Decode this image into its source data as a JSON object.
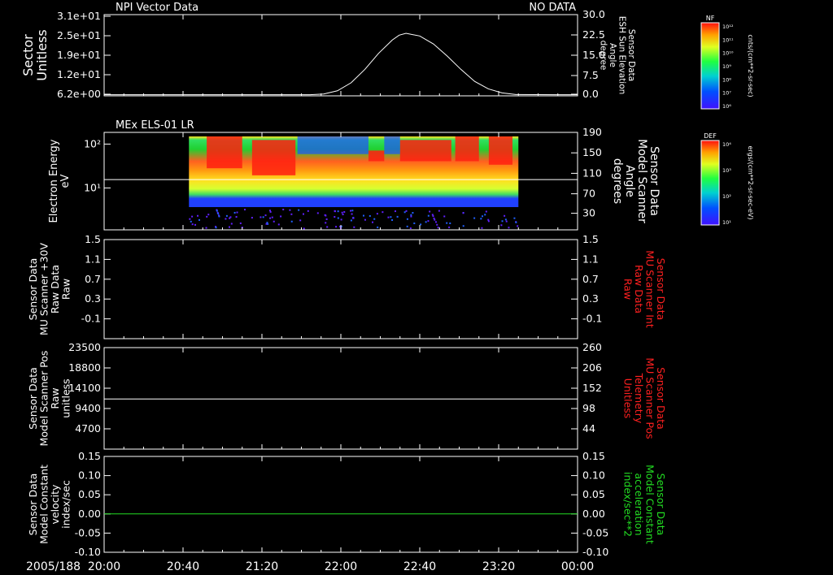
{
  "colors": {
    "background": "#000000",
    "axis": "#ffffff",
    "red_label": "#ff2020",
    "green": "#22dd22"
  },
  "chart_data": [
    {
      "type": "line",
      "title": "NPI Vector Data",
      "title_right": "NO DATA",
      "ylabel": [
        "Sector",
        "Unitless"
      ],
      "yticks": [
        "3.1e+01",
        "2.5e+01",
        "1.9e+01",
        "1.2e+01",
        "6.2e+00"
      ],
      "y2label": [
        "Sensor Data",
        "ESH Sun Elevation",
        "Angle",
        "degree"
      ],
      "y2ticks": [
        "30.0",
        "22.5",
        "15.0",
        "7.5",
        "0.0"
      ],
      "y2lim": [
        -0.4,
        30.0
      ],
      "series": [
        {
          "x": [
            0,
            150,
            160,
            170,
            180,
            190,
            200,
            210,
            215,
            220,
            230,
            240,
            250,
            260,
            270,
            280,
            290,
            300,
            330,
            345
          ],
          "y": [
            0,
            0,
            0.3,
            1.5,
            4.5,
            9.5,
            15.5,
            20.5,
            22.3,
            23.0,
            22.0,
            19.0,
            14.5,
            9.5,
            5.0,
            2.2,
            0.7,
            0.1,
            0,
            0
          ]
        }
      ],
      "color": "#ffffff",
      "colorbar": {
        "label": "NF",
        "units": "cnts/(cm**2-sr-sec)",
        "ticks": [
          "10¹²",
          "10¹¹",
          "10¹⁰",
          "10⁹",
          "10⁸",
          "10⁷",
          "10⁶"
        ]
      }
    },
    {
      "type": "heatmap",
      "title": "MEx ELS-01 LR",
      "ylabel": [
        "Electron Energy",
        "eV"
      ],
      "yticks": [
        "10²",
        "10¹"
      ],
      "y2label": [
        "Sensor Data",
        "Model Scanner",
        "Angle",
        "degrees"
      ],
      "y2ticks": [
        "190",
        "150",
        "110",
        "70",
        "30"
      ],
      "hline_y2": 98,
      "x_start_min": 43,
      "x_end_min": 210,
      "colorbar": {
        "label": "DEF",
        "units": "ergs/(cm**2-sr-sec-eV)",
        "ticks": [
          "10⁴",
          "10³",
          "10²",
          "10¹"
        ]
      }
    },
    {
      "type": "line",
      "ylabel": [
        "Sensor Data",
        "MU Scanner +30V",
        "Raw Data",
        "Raw"
      ],
      "yticks": [
        "1.5",
        "1.1",
        "0.7",
        "0.3",
        "-0.1"
      ],
      "y2label": [
        "Sensor Data",
        "MU Scanner Int",
        "Raw Data",
        "Raw"
      ],
      "y2ticks": [
        "1.5",
        "1.1",
        "0.7",
        "0.3",
        "-0.1"
      ],
      "series": []
    },
    {
      "type": "line",
      "ylabel": [
        "Sensor Data",
        "Model Scanner Pos",
        "Raw",
        "unitless"
      ],
      "yticks": [
        "23500",
        "18800",
        "14100",
        "9400",
        "4700"
      ],
      "y2label": [
        "Sensor Data",
        "MU Scanner Pos",
        "Telemetry",
        "Unitless"
      ],
      "y2ticks": [
        "260",
        "206",
        "152",
        "98",
        "44"
      ],
      "ylim": [
        0,
        23500
      ],
      "series": [
        {
          "value": 11600
        }
      ]
    },
    {
      "type": "line",
      "ylabel": [
        "Sensor Data",
        "Model Constant",
        "velocity",
        "index/sec"
      ],
      "yticks": [
        "0.15",
        "0.10",
        "0.05",
        "0.00",
        "-0.05",
        "-0.10"
      ],
      "y2label": [
        "Sensor Data",
        "Model Constant",
        "acceleration",
        "index/sec**2"
      ],
      "y2ticks": [
        "0.15",
        "0.10",
        "0.05",
        "0.00",
        "-0.05",
        "-0.10"
      ],
      "ylim": [
        -0.1,
        0.15
      ],
      "series": [
        {
          "value": 0.0
        }
      ]
    }
  ],
  "xaxis": {
    "date": "2005/188",
    "ticks": [
      "20:00",
      "20:40",
      "21:20",
      "22:00",
      "22:40",
      "23:20",
      "00:00"
    ],
    "range_min": [
      0,
      240
    ]
  }
}
